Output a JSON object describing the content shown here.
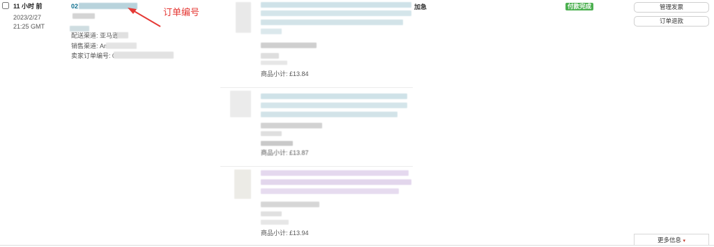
{
  "order": {
    "time_ago": "11 小时 前",
    "date": "2023/2/27",
    "time": "21:25 GMT",
    "order_number_prefix": "02",
    "channel_source_label": "配送渠道: 亚马逊",
    "sales_channel_label": "销售渠道: Am",
    "seller_order_label": "卖家订单编号: 0",
    "shipping_service": "加急",
    "status_badge": "付款完成"
  },
  "annotation": {
    "label": "订单编号",
    "color": "#e53935"
  },
  "items": [
    {
      "subtotal": "商品小计: £13.84"
    },
    {
      "subtotal": "商品小计: £13.87"
    },
    {
      "subtotal": "商品小计: £13.94"
    }
  ],
  "actions": {
    "manage_invoice": "管理发票",
    "refund_order": "订单退款",
    "more_info": "更多信息",
    "more_info_caret": "▾"
  },
  "colors": {
    "link": "#0b6e8e",
    "badge_green": "#4cb050",
    "caret_red": "#c0392b"
  }
}
